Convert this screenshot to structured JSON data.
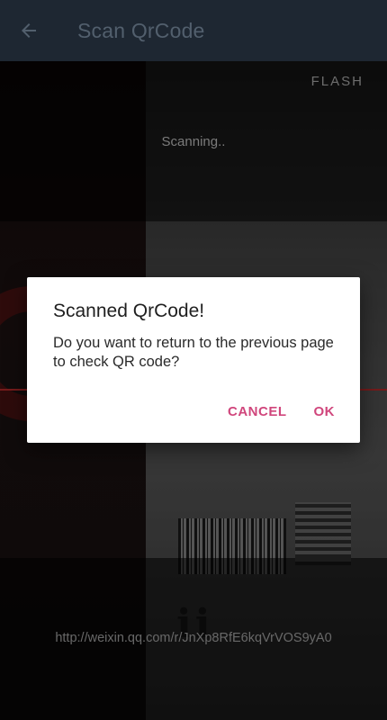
{
  "appbar": {
    "title": "Scan QrCode",
    "back_icon": "arrow-back-icon"
  },
  "scanner": {
    "flash_label": "FLASH",
    "status": "Scanning..",
    "result_text": "http://weixin.qq.com/r/JnXp8RfE6kqVrVOS9yA0",
    "laser_color": "#b42a2a"
  },
  "dialog": {
    "title": "Scanned QrCode!",
    "message": "Do you want to return to the previous page to check QR code?",
    "cancel_label": "CANCEL",
    "ok_label": "OK",
    "accent_color": "#d0467c"
  }
}
